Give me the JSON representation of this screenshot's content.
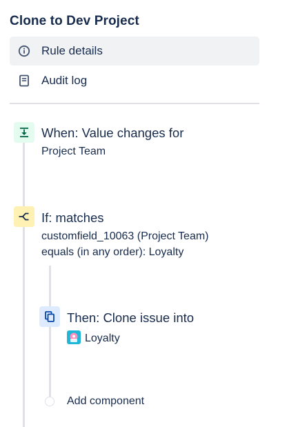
{
  "rule": {
    "title": "Clone to Dev Project"
  },
  "nav": {
    "items": [
      {
        "label": "Rule details",
        "icon": "info-icon",
        "active": true
      },
      {
        "label": "Audit log",
        "icon": "document-icon",
        "active": false
      }
    ]
  },
  "steps": {
    "trigger": {
      "title": "When: Value changes for",
      "detail": "Project Team",
      "icon": "trigger-download-icon",
      "color": "#e3fcef"
    },
    "condition": {
      "title": "If: matches",
      "line1": "customfield_10063 (Project Team)",
      "line2": "equals (in any order): Loyalty",
      "icon": "branch-condition-icon",
      "color": "#fff0b3"
    },
    "action": {
      "title": "Then: Clone issue into",
      "project": "Loyalty",
      "icon": "clone-copy-icon",
      "color": "#deebff"
    },
    "add": {
      "label": "Add component"
    }
  }
}
